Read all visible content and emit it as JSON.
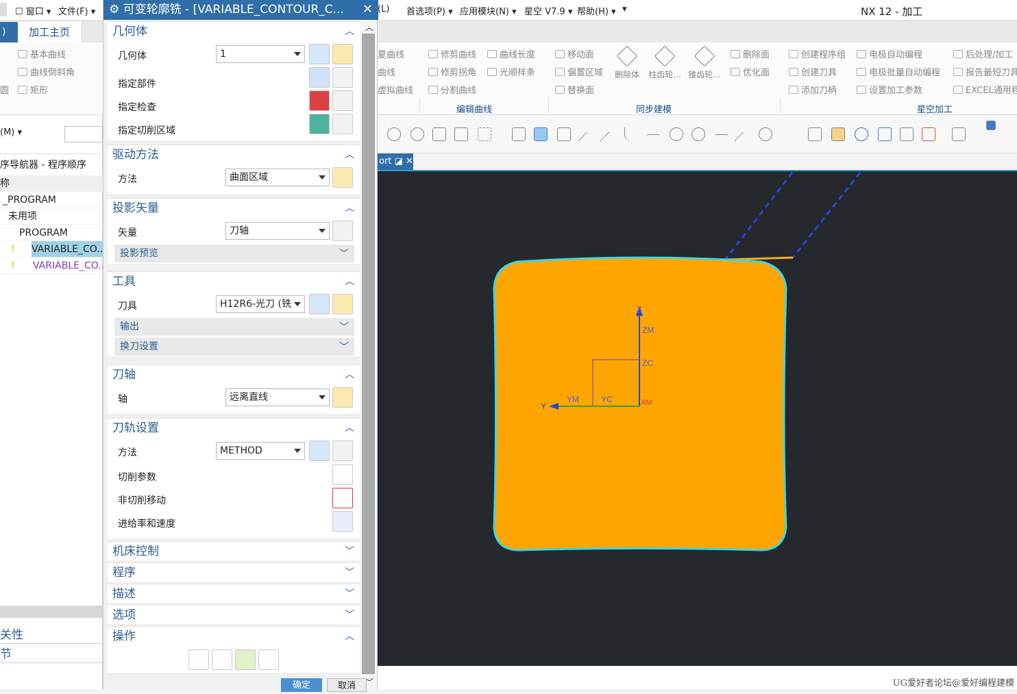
{
  "titlebar": {
    "menus": [
      "窗口 ▾",
      "文件(F) ▾",
      "(L)",
      "首选项(P) ▾",
      "应用模块(N) ▾",
      "星空 V7.9 ▾",
      "帮助(H) ▾"
    ],
    "app_title": "NX 12 - 加工"
  },
  "ribbon": {
    "tab_prefix": ")",
    "active_tab": "加工主页",
    "left_items": [
      "基本曲线",
      "曲线倒斜角",
      "矩形"
    ],
    "left_items_b": [
      "圆"
    ],
    "curve_items": [
      "修剪曲线",
      "修剪拐角",
      "分割曲线",
      "曲线长度",
      "光顺样条"
    ],
    "curve_partial": [
      "夏曲线",
      "曲线",
      "虚拟曲线"
    ],
    "sync_items": [
      "移动面",
      "偏置区域",
      "替换面"
    ],
    "sync_big": [
      "删除体",
      "柱齿轮...",
      "锥齿轮..."
    ],
    "sync_right": [
      "删除面",
      "优化面"
    ],
    "xk_items": [
      "创建程序组",
      "创建刀具",
      "添加刀柄",
      "电极自动编程",
      "电极批量自动编程",
      "设置加工参数",
      "后处理/加工",
      "报告最短刀具",
      "EXCEL通用程"
    ],
    "groups": [
      "编辑曲线",
      "同步建模",
      "星空加工"
    ]
  },
  "nav": {
    "filter": "(M) ▾",
    "title": "序导航器 - 程序顺序",
    "col": "称",
    "rows": [
      "_PROGRAM",
      "未用项",
      "PROGRAM",
      "VARIABLE_CO...",
      "VARIABLE_CO..."
    ],
    "bottom": [
      "关性",
      "节"
    ]
  },
  "dialog": {
    "title": "可变轮廓铣 - [VARIABLE_CONTOUR_C...",
    "sections": {
      "geometry": {
        "title": "几何体",
        "geometry_label": "几何体",
        "geometry_value": "1",
        "part": "指定部件",
        "check": "指定检查",
        "cut_area": "指定切削区域"
      },
      "drive": {
        "title": "驱动方法",
        "method_label": "方法",
        "method_value": "曲面区域"
      },
      "projection": {
        "title": "投影矢量",
        "vector_label": "矢量",
        "vector_value": "刀轴",
        "preview": "投影预览"
      },
      "tool": {
        "title": "工具",
        "tool_label": "刀具",
        "tool_value": "H12R6-光刀 (铣",
        "output": "输出",
        "change": "换刀设置"
      },
      "axis": {
        "title": "刀轴",
        "axis_label": "轴",
        "axis_value": "远离直线"
      },
      "path": {
        "title": "刀轨设置",
        "method_label": "方法",
        "method_value": "METHOD",
        "cut_params": "切削参数",
        "noncut": "非切削移动",
        "feeds": "进给率和速度"
      },
      "machine": {
        "title": "机床控制"
      },
      "program": {
        "title": "程序"
      },
      "description": {
        "title": "描述"
      },
      "options": {
        "title": "选项"
      },
      "actions": {
        "title": "操作"
      }
    },
    "ok": "确定",
    "cancel": "取消"
  },
  "viewport": {
    "tab": "ort",
    "axes": {
      "z": "Z",
      "zm": "ZM",
      "zc": "ZC",
      "y": "Y",
      "ym": "YM",
      "yc": "YC",
      "xm": "XM"
    },
    "colors": {
      "bg": "#25282d",
      "part": "#ffa500",
      "outline": "#3ad7e6",
      "axis": "#1f49d6"
    }
  },
  "watermark": "UG爱好者论坛@爱好编程建模"
}
